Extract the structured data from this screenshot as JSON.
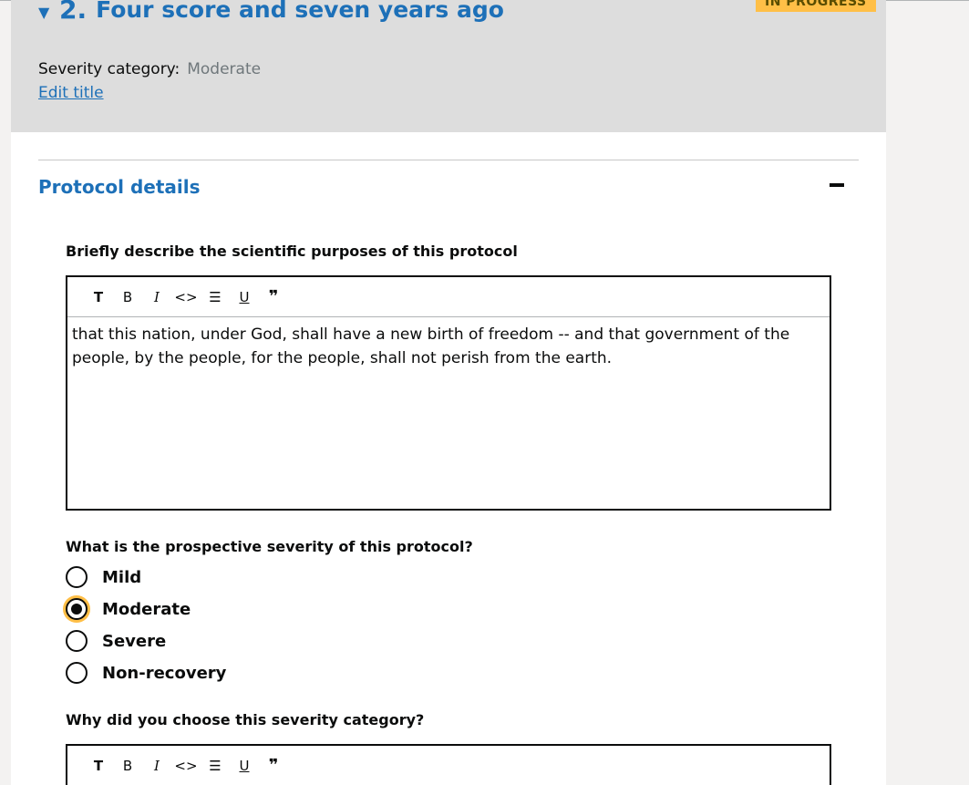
{
  "header": {
    "caret": "▼",
    "number": "2.",
    "title": "Four score and seven years ago",
    "status": "IN PROGRESS",
    "severity_label": "Severity category:",
    "severity_value": "Moderate",
    "edit_title": "Edit title"
  },
  "section": {
    "title": "Protocol details",
    "collapse_icon": "minus-icon"
  },
  "question1": {
    "label": "Briefly describe the scientific purposes of this protocol",
    "text": "that this nation, under God, shall have a new birth of freedom -- and that government of the people, by the people, for the people, shall not perish from the earth."
  },
  "toolbar": {
    "heading": "T",
    "bold": "B",
    "italic": "I",
    "code": "<>",
    "list": "☰",
    "underline": "U",
    "quote": "❞"
  },
  "question2": {
    "label": "What is the prospective severity of this protocol?",
    "options": [
      {
        "label": "Mild",
        "checked": false
      },
      {
        "label": "Moderate",
        "checked": true
      },
      {
        "label": "Severe",
        "checked": false
      },
      {
        "label": "Non-recovery",
        "checked": false
      }
    ]
  },
  "question3": {
    "label": "Why did you choose this severity category?"
  },
  "colors": {
    "link": "#1d70b8",
    "header_bg": "#dddddd",
    "tag_bg": "#ffbf47",
    "focus": "#ffbf47"
  }
}
